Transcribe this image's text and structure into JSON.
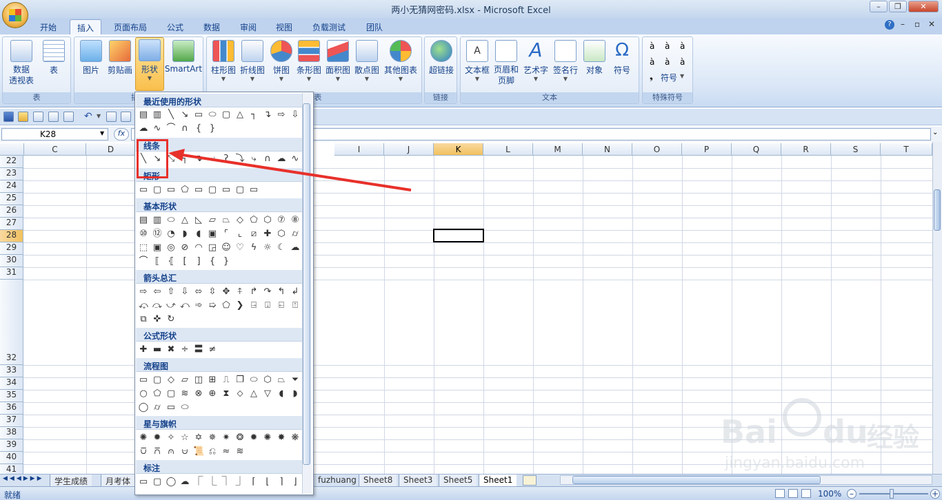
{
  "window": {
    "title": "两小无猜网密码.xlsx - Microsoft Excel"
  },
  "tabs": [
    "开始",
    "插入",
    "页面布局",
    "公式",
    "数据",
    "审阅",
    "视图",
    "负载测试",
    "团队"
  ],
  "ribbon": {
    "groups": {
      "table": "表",
      "illus": "插图",
      "charts": "图表",
      "links": "链接",
      "text": "文本",
      "special": "特殊符号"
    },
    "buttons": {
      "pivot": "数据\n透视表",
      "table": "表",
      "picture": "图片",
      "clipart": "剪贴画",
      "shapes": "形状",
      "smartart": "SmartArt",
      "col": "柱形图",
      "line": "折线图",
      "pie": "饼图",
      "bar": "条形图",
      "area": "面积图",
      "scatter": "散点图",
      "other": "其他图表",
      "hyperlink": "超链接",
      "textbox": "文本框",
      "header": "页眉和\n页脚",
      "wordart": "艺术字",
      "sigline": "签名行",
      "object": "对象",
      "symbol": "符号",
      "symbol2": "符号"
    },
    "special_chars": [
      "à",
      "à",
      "à",
      "à",
      "à",
      "à"
    ]
  },
  "namebox": "K28",
  "fx": "fx",
  "columns": [
    "C",
    "D",
    "",
    "",
    "",
    "I",
    "J",
    "K",
    "L",
    "M",
    "N",
    "O",
    "P",
    "Q",
    "R",
    "S",
    "T"
  ],
  "rows": [
    "22",
    "23",
    "24",
    "25",
    "26",
    "27",
    "28",
    "29",
    "30",
    "31",
    "32",
    "33",
    "34",
    "35",
    "36",
    "37",
    "38",
    "39",
    "40",
    "41"
  ],
  "shapes_menu": {
    "recent": "最近使用的形状",
    "lines": "线条",
    "rect": "矩形",
    "basic": "基本形状",
    "arrows": "箭头总汇",
    "equation": "公式形状",
    "flowchart": "流程图",
    "stars": "星与旗帜",
    "callouts": "标注"
  },
  "sheet_tabs": [
    "学生成绩",
    "月考体",
    "fuzhuang",
    "Sheet8",
    "Sheet3",
    "Sheet5",
    "Sheet1"
  ],
  "status": {
    "ready": "就绪",
    "zoom": "100%"
  },
  "watermark": {
    "brand": "Bai",
    "brand2": "du",
    "brand_cn": "经验",
    "url": "jingyan.baidu.com"
  }
}
